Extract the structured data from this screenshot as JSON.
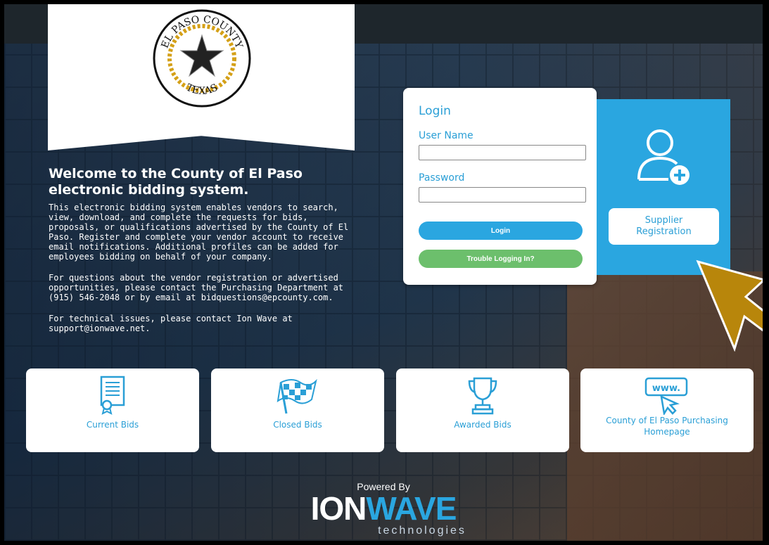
{
  "logo": {
    "seal_text_top": "EL PASO COUNTY",
    "seal_text_bottom": "TEXAS"
  },
  "welcome": {
    "heading": "Welcome to the County of El Paso electronic bidding system.",
    "paragraph1": "This electronic bidding system enables vendors to search, view, download, and complete the requests for bids, proposals, or qualifications advertised by the County of El Paso.  Register and complete your vendor account to receive email notifications. Additional profiles can be added for employees bidding on behalf of your company.",
    "paragraph2": "For questions about the vendor registration or advertised opportunities, please contact the Purchasing Department at (915) 546-2048 or by email at bidquestions@epcounty.com.",
    "paragraph3": "For technical issues, please contact Ion Wave at support@ionwave.net."
  },
  "login": {
    "title": "Login",
    "username_label": "User Name",
    "username_value": "",
    "password_label": "Password",
    "password_value": "",
    "login_button": "Login",
    "trouble_button": "Trouble Logging In?"
  },
  "supplier": {
    "icon": "add-user-icon",
    "button_label": "Supplier Registration",
    "color": "#2aa6e0"
  },
  "tiles": [
    {
      "label": "Current Bids",
      "icon": "document-certificate-icon"
    },
    {
      "label": "Closed Bids",
      "icon": "checkered-flag-icon"
    },
    {
      "label": "Awarded Bids",
      "icon": "trophy-icon"
    },
    {
      "label": "County of El Paso Purchasing Homepage",
      "icon": "www-cursor-icon"
    }
  ],
  "footer": {
    "powered_by": "Powered By",
    "brand_ion": "ION",
    "brand_wave": "WAVE",
    "brand_tech": "technologies"
  },
  "colors": {
    "accent": "#2aa6e0",
    "success": "#6cbf6c",
    "arrow": "#b8860b"
  }
}
